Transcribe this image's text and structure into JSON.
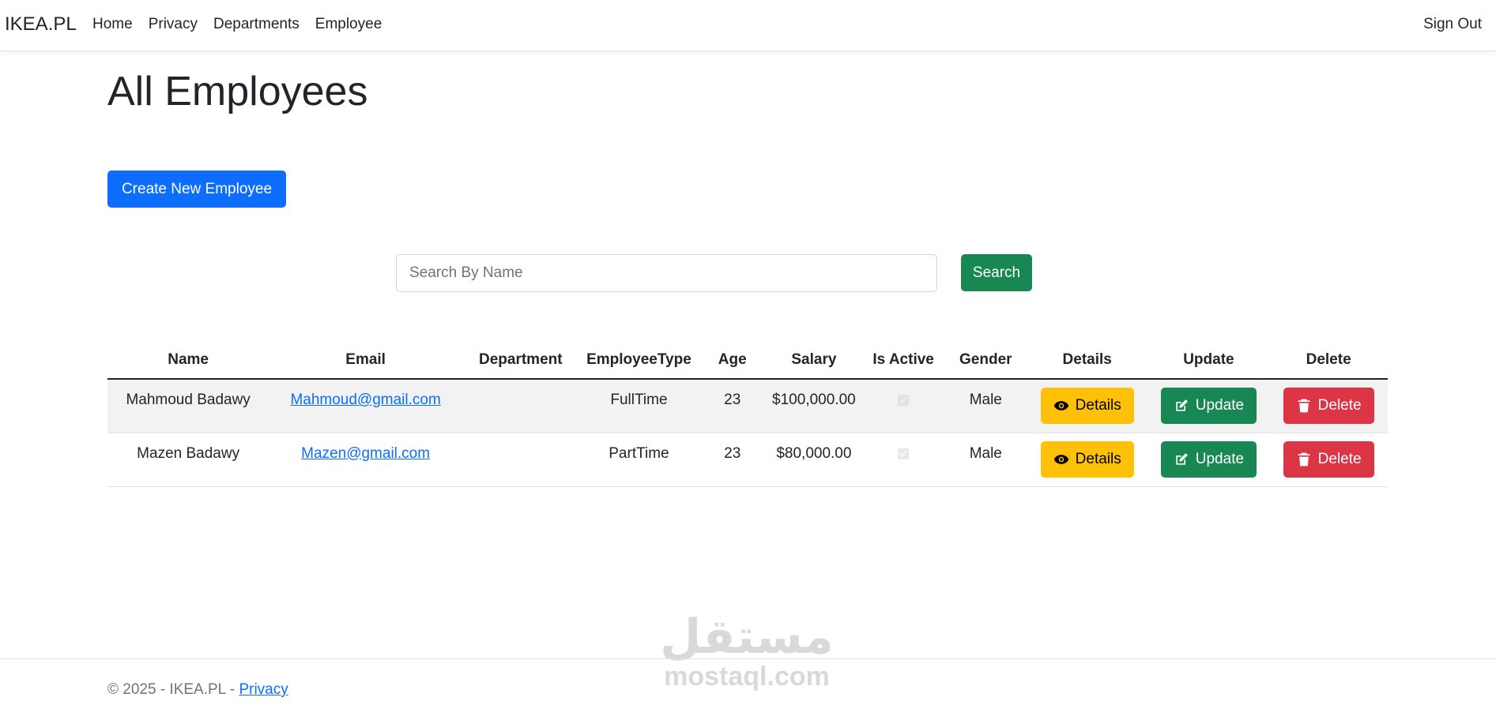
{
  "navbar": {
    "brand": "IKEA.PL",
    "links": [
      "Home",
      "Privacy",
      "Departments",
      "Employee"
    ],
    "sign_out": "Sign Out"
  },
  "page": {
    "title": "All Employees",
    "create_button": "Create New Employee"
  },
  "search": {
    "placeholder": "Search By Name",
    "value": "",
    "button": "Search"
  },
  "table": {
    "headers": [
      "Name",
      "Email",
      "Department",
      "EmployeeType",
      "Age",
      "Salary",
      "Is Active",
      "Gender",
      "Details",
      "Update",
      "Delete"
    ],
    "rows": [
      {
        "name": "Mahmoud Badawy",
        "email": "Mahmoud@gmail.com",
        "department": "",
        "type": "FullTime",
        "age": "23",
        "salary": "$100,000.00",
        "is_active": true,
        "gender": "Male",
        "details": "Details",
        "update": "Update",
        "delete": "Delete"
      },
      {
        "name": "Mazen Badawy",
        "email": "Mazen@gmail.com",
        "department": "",
        "type": "PartTime",
        "age": "23",
        "salary": "$80,000.00",
        "is_active": true,
        "gender": "Male",
        "details": "Details",
        "update": "Update",
        "delete": "Delete"
      }
    ]
  },
  "footer": {
    "text": "© 2025 - IKEA.PL - ",
    "privacy": "Privacy"
  },
  "watermark": {
    "arabic": "مستقل",
    "latin": "mostaql.com"
  },
  "colors": {
    "primary": "#0d6efd",
    "success": "#198754",
    "warning": "#ffc107",
    "danger": "#dc3545"
  },
  "icons": {
    "details": "eye-icon",
    "update": "edit-icon",
    "delete": "trash-icon"
  }
}
